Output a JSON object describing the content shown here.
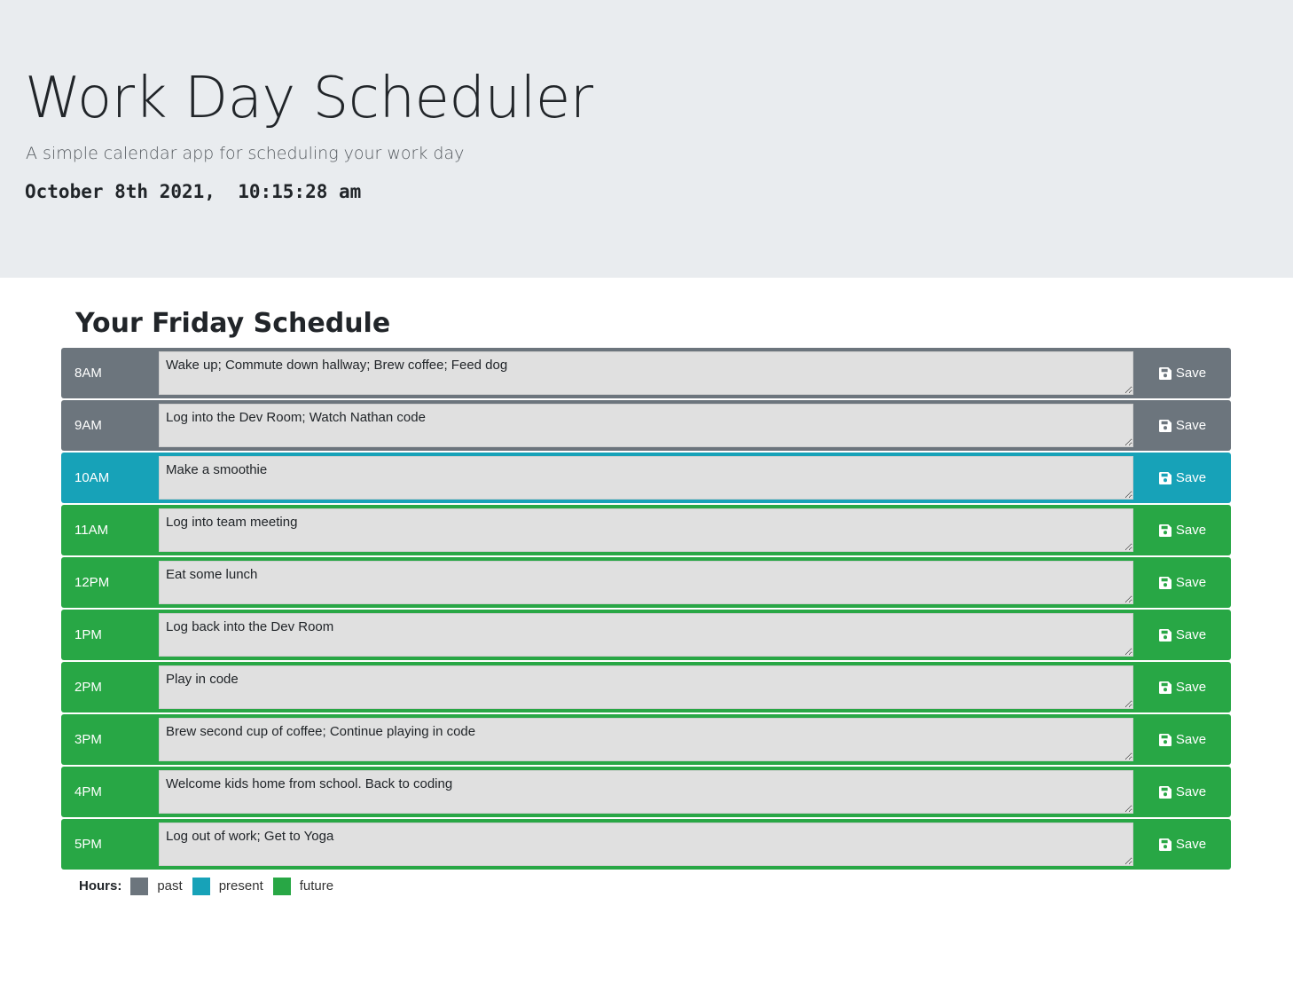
{
  "header": {
    "title": "Work Day Scheduler",
    "subtitle": "A simple calendar app for scheduling your work day",
    "current_datetime": "October 8th 2021,  10:15:28 am"
  },
  "schedule": {
    "heading": "Your Friday Schedule",
    "save_label": "Save",
    "save_icon": "floppy-disk-icon",
    "rows": [
      {
        "hour": "8AM",
        "status": "past",
        "text": "Wake up; Commute down hallway; Brew coffee; Feed dog"
      },
      {
        "hour": "9AM",
        "status": "past",
        "text": "Log into the Dev Room; Watch Nathan code"
      },
      {
        "hour": "10AM",
        "status": "present",
        "text": "Make a smoothie"
      },
      {
        "hour": "11AM",
        "status": "future",
        "text": "Log into team meeting"
      },
      {
        "hour": "12PM",
        "status": "future",
        "text": "Eat some lunch"
      },
      {
        "hour": "1PM",
        "status": "future",
        "text": "Log back into the Dev Room"
      },
      {
        "hour": "2PM",
        "status": "future",
        "text": "Play in code"
      },
      {
        "hour": "3PM",
        "status": "future",
        "text": "Brew second cup of coffee; Continue playing in code"
      },
      {
        "hour": "4PM",
        "status": "future",
        "text": "Welcome kids home from school. Back to coding"
      },
      {
        "hour": "5PM",
        "status": "future",
        "text": "Log out of work; Get to Yoga"
      }
    ]
  },
  "legend": {
    "title": "Hours:",
    "items": [
      {
        "label": "past",
        "color": "#6c757d"
      },
      {
        "label": "present",
        "color": "#17a2b8"
      },
      {
        "label": "future",
        "color": "#28a745"
      }
    ]
  },
  "colors": {
    "past": "#6c757d",
    "present": "#17a2b8",
    "future": "#28a745",
    "header_background": "#e9ecef"
  }
}
